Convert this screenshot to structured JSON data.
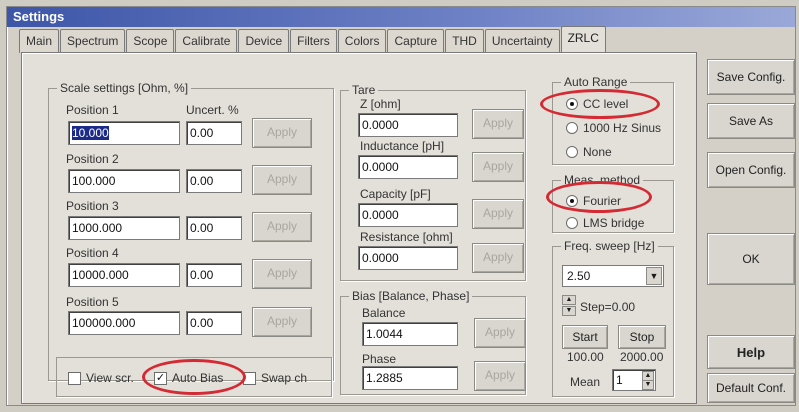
{
  "window": {
    "title": "Settings"
  },
  "tabs": [
    {
      "label": "Main"
    },
    {
      "label": "Spectrum"
    },
    {
      "label": "Scope"
    },
    {
      "label": "Calibrate"
    },
    {
      "label": "Device"
    },
    {
      "label": "Filters"
    },
    {
      "label": "Colors"
    },
    {
      "label": "Capture"
    },
    {
      "label": "THD"
    },
    {
      "label": "Uncertainty"
    },
    {
      "label": "ZRLC",
      "active": true
    }
  ],
  "scale": {
    "legend": "Scale settings [Ohm, %]",
    "uncert_header": "Uncert. %",
    "apply_label": "Apply",
    "positions": [
      {
        "label": "Position 1",
        "value": "10.000",
        "uncert": "0.00"
      },
      {
        "label": "Position 2",
        "value": "100.000",
        "uncert": "0.00"
      },
      {
        "label": "Position 3",
        "value": "1000.000",
        "uncert": "0.00"
      },
      {
        "label": "Position 4",
        "value": "10000.000",
        "uncert": "0.00"
      },
      {
        "label": "Position 5",
        "value": "100000.000",
        "uncert": "0.00"
      }
    ]
  },
  "options": {
    "view_label": "View scr.",
    "auto_bias_label": "Auto Bias",
    "swap_label": "Swap ch",
    "view_checked": false,
    "auto_bias_checked": true,
    "swap_checked": false
  },
  "tare": {
    "legend": "Tare",
    "apply_label": "Apply",
    "fields": [
      {
        "label": "Z [ohm]",
        "value": "0.0000"
      },
      {
        "label": "Inductance [pH]",
        "value": "0.0000"
      },
      {
        "label": "Capacity [pF]",
        "value": "0.0000"
      },
      {
        "label": "Resistance [ohm]",
        "value": "0.0000"
      }
    ]
  },
  "bias": {
    "legend": "Bias [Balance, Phase]",
    "apply_label": "Apply",
    "balance_label": "Balance",
    "balance_value": "1.0044",
    "phase_label": "Phase",
    "phase_value": "1.2885"
  },
  "auto_range": {
    "legend": "Auto Range",
    "options": [
      {
        "label": "CC level",
        "selected": true
      },
      {
        "label": "1000 Hz Sinus",
        "selected": false
      },
      {
        "label": "None",
        "selected": false
      }
    ]
  },
  "meas_method": {
    "legend": "Meas. method",
    "options": [
      {
        "label": "Fourier",
        "selected": true
      },
      {
        "label": "LMS bridge",
        "selected": false
      }
    ]
  },
  "freq_sweep": {
    "legend": "Freq. sweep [Hz]",
    "selected": "2.50",
    "step_label": "Step=0.00",
    "start_label": "Start",
    "stop_label": "Stop",
    "start_value": "100.00",
    "stop_value": "2000.00",
    "mean_label": "Mean",
    "mean_value": "1"
  },
  "side_buttons": {
    "save_config": "Save Config.",
    "save_as": "Save As",
    "open_config": "Open Config.",
    "ok": "OK",
    "help": "Help",
    "default_conf": "Default Conf."
  },
  "colors": {
    "highlight_ring": "#d42a33",
    "title_bar": "#3d56a8"
  }
}
